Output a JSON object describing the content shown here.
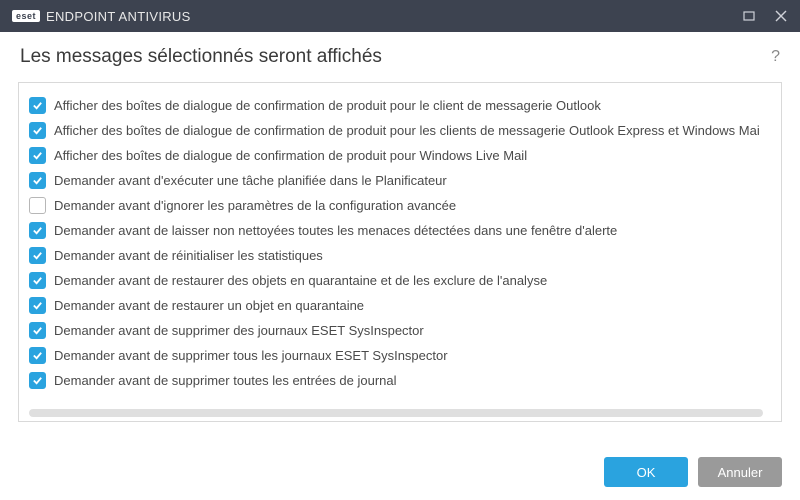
{
  "titlebar": {
    "brand_badge": "eset",
    "brand_text": "ENDPOINT ANTIVIRUS"
  },
  "header": {
    "title": "Les messages sélectionnés seront affichés",
    "help": "?"
  },
  "items": [
    {
      "checked": true,
      "label": "Afficher des boîtes de dialogue de confirmation de produit pour le client de messagerie Outlook"
    },
    {
      "checked": true,
      "label": "Afficher des boîtes de dialogue de confirmation de produit pour les clients de messagerie Outlook Express et Windows Mai"
    },
    {
      "checked": true,
      "label": "Afficher des boîtes de dialogue de confirmation de produit pour Windows Live Mail"
    },
    {
      "checked": true,
      "label": "Demander avant d'exécuter une tâche planifiée dans le Planificateur"
    },
    {
      "checked": false,
      "label": "Demander avant d'ignorer les paramètres de la configuration avancée"
    },
    {
      "checked": true,
      "label": "Demander avant de laisser non nettoyées toutes les menaces détectées dans une fenêtre d'alerte"
    },
    {
      "checked": true,
      "label": "Demander avant de réinitialiser les statistiques"
    },
    {
      "checked": true,
      "label": "Demander avant de restaurer des objets en quarantaine et de les exclure de l'analyse"
    },
    {
      "checked": true,
      "label": "Demander avant de restaurer un objet en quarantaine"
    },
    {
      "checked": true,
      "label": "Demander avant de supprimer des journaux ESET SysInspector"
    },
    {
      "checked": true,
      "label": "Demander avant de supprimer tous les journaux ESET SysInspector"
    },
    {
      "checked": true,
      "label": "Demander avant de supprimer toutes les entrées de journal"
    }
  ],
  "footer": {
    "ok": "OK",
    "cancel": "Annuler"
  }
}
